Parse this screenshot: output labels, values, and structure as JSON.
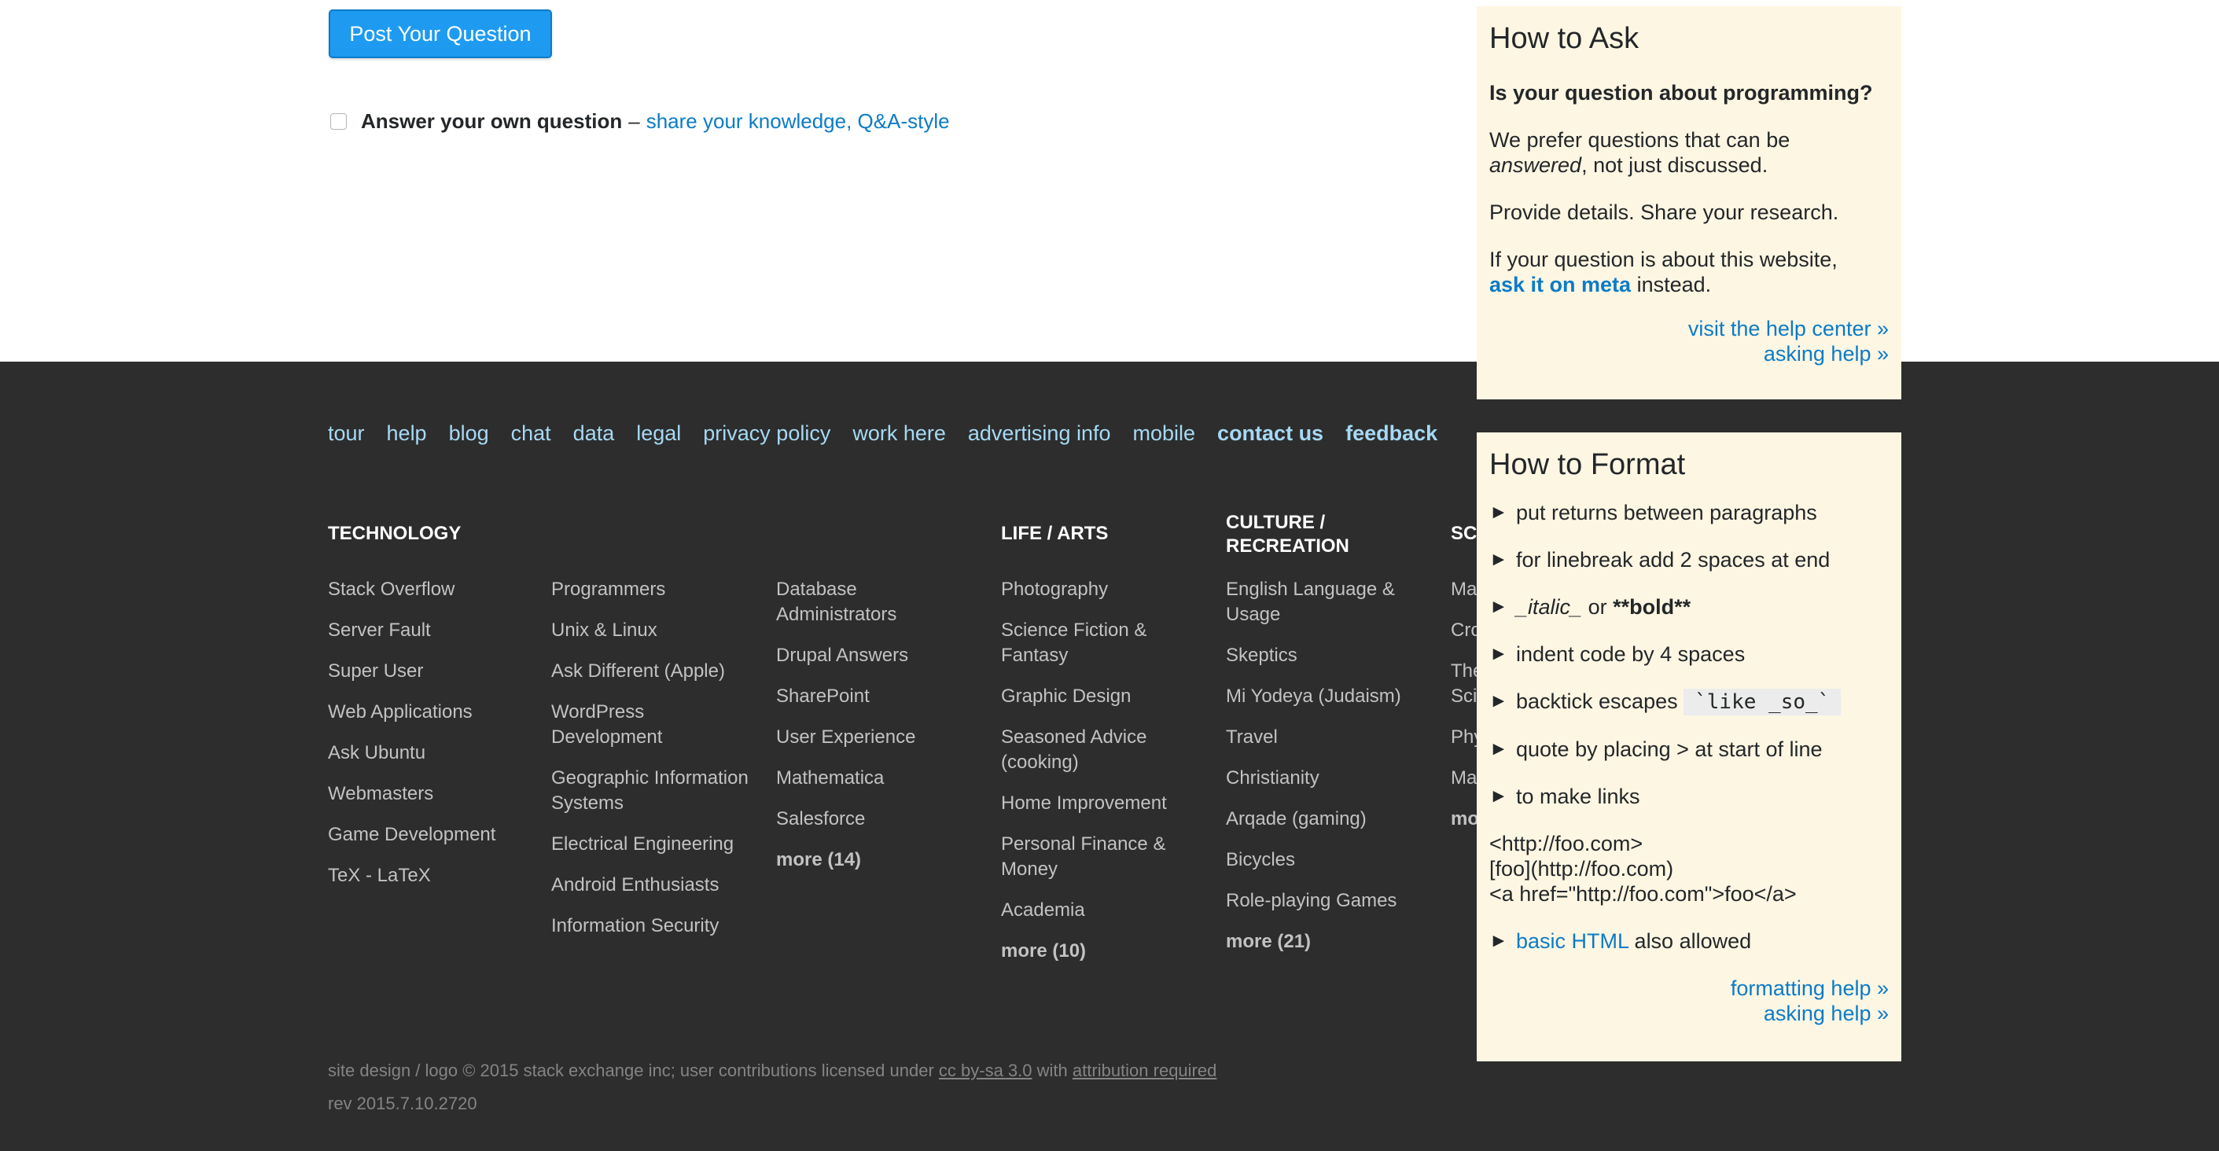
{
  "post_button": {
    "label": "Post Your Question"
  },
  "own_answer": {
    "label": "Answer your own question",
    "separator": "–",
    "link": "share your knowledge, Q&A-style",
    "checked": false
  },
  "footer": {
    "nav": [
      {
        "label": "tour",
        "bold": false
      },
      {
        "label": "help",
        "bold": false
      },
      {
        "label": "blog",
        "bold": false
      },
      {
        "label": "chat",
        "bold": false
      },
      {
        "label": "data",
        "bold": false
      },
      {
        "label": "legal",
        "bold": false
      },
      {
        "label": "privacy policy",
        "bold": false
      },
      {
        "label": "work here",
        "bold": false
      },
      {
        "label": "advertising info",
        "bold": false
      },
      {
        "label": "mobile",
        "bold": false
      },
      {
        "label": "contact us",
        "bold": true
      },
      {
        "label": "feedback",
        "bold": true
      }
    ],
    "columns": [
      {
        "heading": "Technology",
        "sites": [
          "Stack Overflow",
          "Server Fault",
          "Super User",
          "Web Applications",
          "Ask Ubuntu",
          "Webmasters",
          "Game Development",
          "TeX - LaTeX"
        ],
        "more": ""
      },
      {
        "heading": "",
        "sites": [
          "Programmers",
          "Unix & Linux",
          "Ask Different (Apple)",
          "WordPress Development",
          "Geographic Information Systems",
          "Electrical Engineering",
          "Android Enthusiasts",
          "Information Security"
        ],
        "more": ""
      },
      {
        "heading": "",
        "sites": [
          "Database Administrators",
          "Drupal Answers",
          "SharePoint",
          "User Experience",
          "Mathematica",
          "Salesforce"
        ],
        "more": "more (14)"
      },
      {
        "heading": "Life / Arts",
        "sites": [
          "Photography",
          "Science Fiction & Fantasy",
          "Graphic Design",
          "Seasoned Advice (cooking)",
          "Home Improvement",
          "Personal Finance & Money",
          "Academia"
        ],
        "more": "more (10)"
      },
      {
        "heading": "Culture / Recreation",
        "sites": [
          "English Language & Usage",
          "Skeptics",
          "Mi Yodeya (Judaism)",
          "Travel",
          "Christianity",
          "Arqade (gaming)",
          "Bicycles",
          "Role-playing Games"
        ],
        "more": "more (21)"
      },
      {
        "heading": "Sc",
        "sites": [
          "Ma",
          "Cro",
          "The Sci",
          "Phy",
          "Ma"
        ],
        "more": "mo"
      }
    ],
    "legal": {
      "prefix": "site design / logo © 2015 stack exchange inc; user contributions licensed under",
      "license_link": "cc by-sa 3.0",
      "middle": "with",
      "attribution_link": "attribution required"
    },
    "rev": "rev 2015.7.10.2720"
  },
  "how_to_ask": {
    "title": "How to Ask",
    "question": "Is your question about programming?",
    "p1_prefix": "We prefer questions that can be",
    "p1_em": "answered",
    "p1_suffix": ", not just discussed.",
    "p2": "Provide details. Share your research.",
    "p3_prefix": "If your question is about this website,",
    "p3_link": "ask it on meta",
    "p3_suffix": "instead.",
    "links": [
      "visit the help center »",
      "asking help »"
    ]
  },
  "how_to_format": {
    "title": "How to Format",
    "bullet_icon": "►",
    "items": {
      "returns": "put returns between paragraphs",
      "linebreak": "for linebreak add 2 spaces at end",
      "italic": "_italic_",
      "or": "or",
      "bold": "**bold**",
      "indent": "indent code by 4 spaces",
      "backtick": "backtick escapes",
      "backtick_code": "`like _so_`",
      "quote": "quote by placing > at start of line",
      "links": "to make links",
      "html_link": "basic HTML",
      "html_suffix": "also allowed"
    },
    "link_examples": [
      "<http://foo.com>",
      "[foo](http://foo.com)",
      "<a href=\"http://foo.com\">foo</a>"
    ],
    "help_links": [
      "formatting help »",
      "asking help »"
    ]
  },
  "colors": {
    "accent": "#1e9bf1",
    "link": "#0c7bc7",
    "footer_bg": "#2d2d2d",
    "footer_link": "#a6d9f4",
    "panel_bg": "#fdf6e3"
  }
}
